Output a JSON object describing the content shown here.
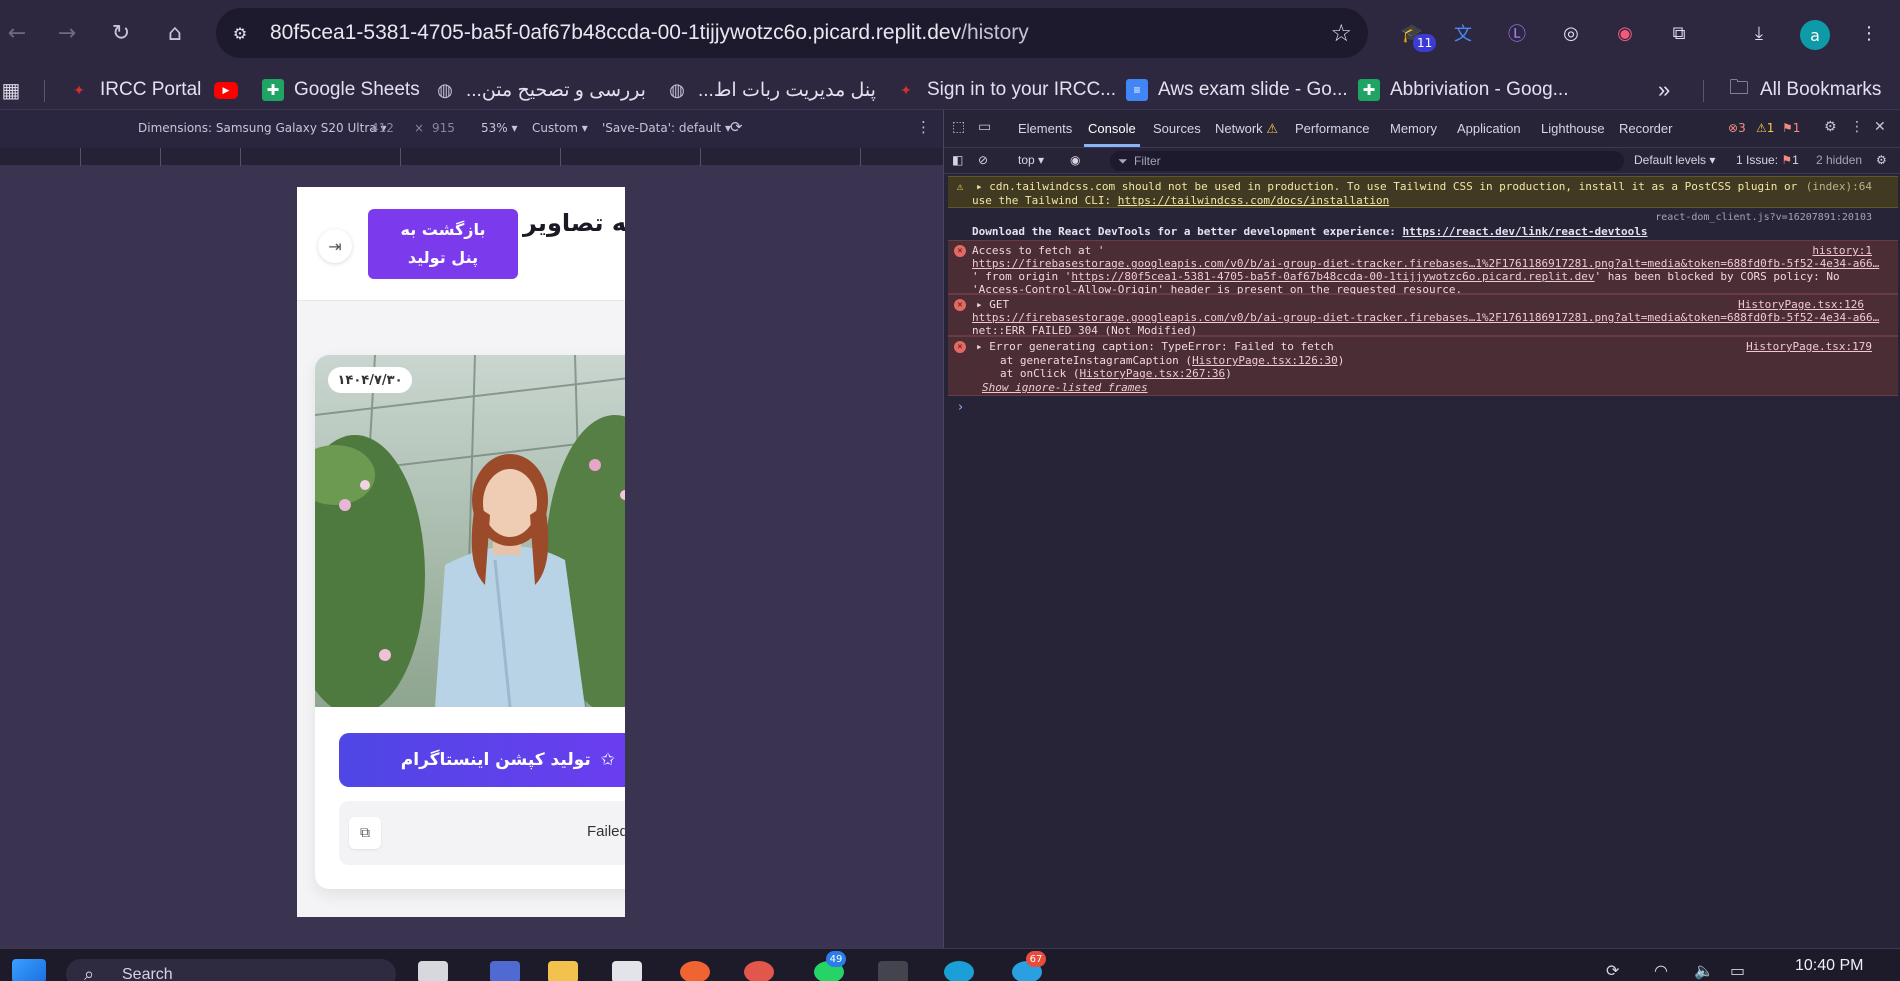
{
  "browser": {
    "url_host": "80f5cea1-5381-4705-ba5f-0af67b48ccda-00-1tijjywotzc6o.picard.replit.dev",
    "url_path": "/history",
    "extension_badge": "11",
    "profile_initial": "a"
  },
  "bookmarks": [
    {
      "label": "IRCC Portal",
      "icon": "maple-leaf-icon",
      "color": "#d32f2f"
    },
    {
      "label": "",
      "icon": "youtube-icon",
      "color": "#ff0000"
    },
    {
      "label": "Google Sheets",
      "icon": "sheets-icon",
      "color": "#1fa463"
    },
    {
      "label": "بررسی و تصحیح متن...",
      "icon": "globe-icon",
      "color": "#c9c4d8"
    },
    {
      "label": "پنل مدیریت ربات اط...",
      "icon": "globe-icon",
      "color": "#c9c4d8"
    },
    {
      "label": "Sign in to your IRCC...",
      "icon": "maple-leaf-icon",
      "color": "#d32f2f"
    },
    {
      "label": "Aws exam slide - Go...",
      "icon": "slides-icon",
      "color": "#4285f4"
    },
    {
      "label": "Abbriviation - Goog...",
      "icon": "sheets-icon",
      "color": "#1fa463"
    }
  ],
  "all_bookmarks_label": "All Bookmarks",
  "device_toolbar": {
    "dimensions_label": "Dimensions: Samsung Galaxy S20 Ultra",
    "width": "412",
    "times": "×",
    "height": "915",
    "zoom": "53%",
    "throttle": "Custom",
    "save_data": "'Save-Data': default"
  },
  "app": {
    "page_title": "چه تصاویر",
    "back_button": "بازگشت به پنل تولید",
    "date_badge": "۱۴۰۴/۷/۳۰",
    "generate_button": "تولید کپشن اینستاگرام",
    "result_text": "Failed"
  },
  "devtools": {
    "tabs": [
      "Elements",
      "Console",
      "Sources",
      "Network",
      "Performance",
      "Memory",
      "Application",
      "Lighthouse",
      "Recorder"
    ],
    "active_tab": "Console",
    "error_count": "3",
    "warning_count": "1",
    "issue_count_top": "1",
    "context": "top",
    "filter_placeholder": "Filter",
    "levels": "Default levels",
    "issues_label": "1 Issue:",
    "issues_count": "1",
    "hidden_label": "2 hidden",
    "messages": {
      "warn1_line1": "cdn.tailwindcss.com should not be used in production. To use Tailwind CSS in production, install it as a PostCSS plugin or",
      "warn1_line2_prefix": "use the Tailwind CLI: ",
      "warn1_link": "https://tailwindcss.com/docs/installation",
      "warn1_src": "(index):64",
      "info_src": "react-dom_client.js?v=16207891:20103",
      "info_prefix": "Download the React DevTools for a better development experience: ",
      "info_link": "https://react.dev/link/react-devtools",
      "err1_line1": "Access to fetch at '",
      "err1_src": "history:1",
      "err1_link": "https://firebasestorage.googleapis.com/v0/b/ai-group-diet-tracker.firebases…1%2F1761186917281.png?alt=media&token=688fd0fb-5f52-4e34-a66…",
      "err1_line3_prefix": "' from origin '",
      "err1_origin": "https://80f5cea1-5381-4705-ba5f-0af67b48ccda-00-1tijjywotzc6o.picard.replit.dev",
      "err1_line3_suffix": "' has been blocked by CORS policy: No",
      "err1_line4": "'Access-Control-Allow-Origin' header is present on the requested resource.",
      "err2_line1": "GET",
      "err2_src": "HistoryPage.tsx:126",
      "err2_link": "https://firebasestorage.googleapis.com/v0/b/ai-group-diet-tracker.firebases…1%2F1761186917281.png?alt=media&token=688fd0fb-5f52-4e34-a66…",
      "err2_line3": "net::ERR_FAILED 304 (Not Modified)",
      "err3_line1": "Error generating caption: TypeError: Failed to fetch",
      "err3_src": "HistoryPage.tsx:179",
      "err3_line2_prefix": "at generateInstagramCaption (",
      "err3_line2_link": "HistoryPage.tsx:126:30",
      "err3_line2_suffix": ")",
      "err3_line3_prefix": "at onClick (",
      "err3_line3_link": "HistoryPage.tsx:267:36",
      "err3_line3_suffix": ")",
      "err3_line4": "Show ignore-listed frames"
    }
  },
  "taskbar": {
    "search_label": "Search",
    "whatsapp_badge": "49",
    "app_badge": "67",
    "clock": "10:40 PM"
  }
}
